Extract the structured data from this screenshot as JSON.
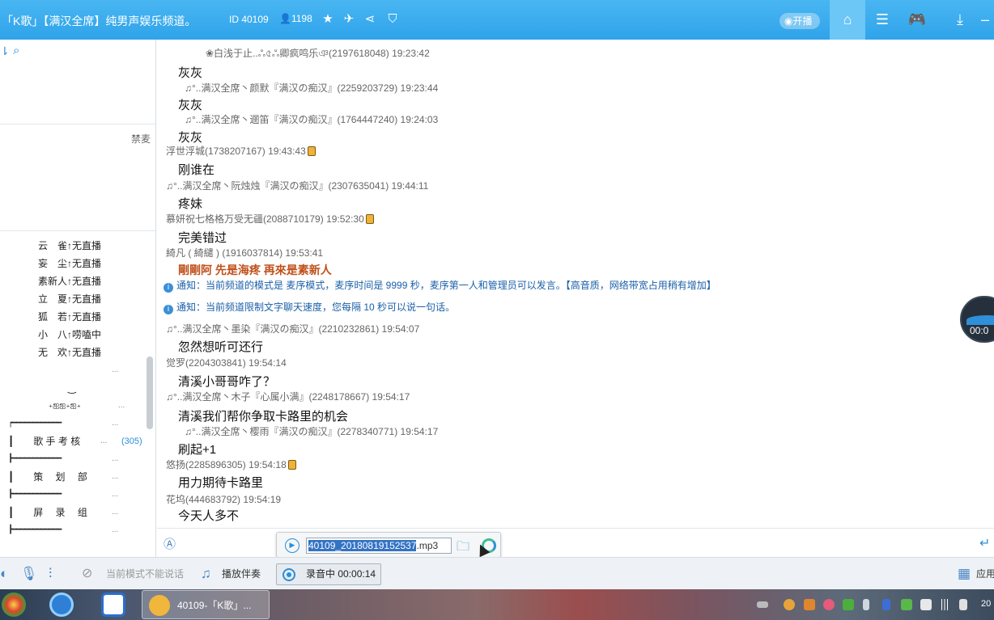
{
  "titlebar": {
    "title": "「K歌」【满汉全席】纯男声娱乐频道。",
    "id_label": "ID 40109",
    "user_count": "1198",
    "live_label": "开播",
    "icons": [
      "star-icon",
      "plane-icon",
      "share-icon",
      "shield-icon"
    ],
    "nav": [
      "home-icon",
      "list-icon",
      "gamepad-icon",
      "download-icon"
    ]
  },
  "left": {
    "ban_label": "禁麦",
    "members": [
      {
        "name": "云　雀",
        "status": "无直播"
      },
      {
        "name": "妄　尘",
        "status": "无直播"
      },
      {
        "name": "素新人",
        "status": "无直播"
      },
      {
        "name": "立　夏",
        "status": "无直播"
      },
      {
        "name": "狐　若",
        "status": "无直播"
      },
      {
        "name": "小　八",
        "status": "唠嗑中"
      },
      {
        "name": "无　欢",
        "status": "无直播"
      }
    ],
    "channels": [
      {
        "text": "",
        "dots": "..."
      },
      {
        "text": "‿",
        "dots": ""
      },
      {
        "text": "₊ஐஐ₊ஐ₊",
        "dots": "..."
      },
      {
        "text": "┍━━━━━━━━━━━━",
        "dots": "..."
      },
      {
        "text": "┃　　歌 手 考 核",
        "dots": "...",
        "count": "(305)"
      },
      {
        "text": "┣━━━━━━━━━━━━",
        "dots": "..."
      },
      {
        "text": "┃　　策　 划　 部",
        "dots": "..."
      },
      {
        "text": "┣━━━━━━━━━━━━",
        "dots": "..."
      },
      {
        "text": "┃　　屏　 录　 组",
        "dots": "..."
      },
      {
        "text": "┣━━━━━━━━━━━━",
        "dots": "..."
      }
    ]
  },
  "chat": {
    "lines": [
      {
        "kind": "meta",
        "text": "❀白浅于止..ஃ৫ஃ卿疯鸣乐ঞ(2197618048) 19:23:42",
        "indent": 60
      },
      {
        "kind": "msg",
        "text": "灰灰",
        "indent": 26
      },
      {
        "kind": "meta",
        "text": "♫°..满汉全席丶颜默『满汉の痴汉』(2259203729) 19:23:44",
        "indent": 34
      },
      {
        "kind": "msg",
        "text": "灰灰",
        "indent": 26
      },
      {
        "kind": "meta",
        "text": "♫°..满汉全席丶逦笛『满汉の痴汉』(1764447240) 19:24:03",
        "indent": 34
      },
      {
        "kind": "msg",
        "text": "灰灰",
        "indent": 26
      },
      {
        "kind": "meta",
        "text": "浮世浮城(1738207167) 19:43:43",
        "indent": 11,
        "phone": true
      },
      {
        "kind": "msg",
        "text": "刚谁在",
        "indent": 26
      },
      {
        "kind": "meta",
        "text": "♫°..满汉全席丶阮烛烛『满汉の痴汉』(2307635041) 19:44:11",
        "indent": 11
      },
      {
        "kind": "msg",
        "text": "疼妹",
        "indent": 26
      },
      {
        "kind": "meta",
        "text": "慕妍祝七格格万受无疆(2088710179) 19:52:30",
        "indent": 11,
        "phone": true
      },
      {
        "kind": "msg",
        "text": "完美错过",
        "indent": 26
      },
      {
        "kind": "meta",
        "text": "綺凡 ( 綺繾 ) (1916037814) 19:53:41",
        "indent": 11
      },
      {
        "kind": "hl",
        "text": "剛剛阿  先是海疼  再來是素新人",
        "indent": 26
      },
      {
        "kind": "notice",
        "text": "通知：当前频道的模式是 麦序模式，麦序时间是 9999 秒，麦序第一人和管理员可以发言。【高音质，网络带宽占用稍有增加】",
        "indent": 8
      },
      {
        "kind": "notice",
        "text": "通知：当前频道限制文字聊天速度，您每隔 10 秒可以说一句话。",
        "indent": 8
      },
      {
        "kind": "meta",
        "text": "♫°..满汉全席丶墨染『满汉の痴汉』(2210232861) 19:54:07",
        "indent": 11
      },
      {
        "kind": "msg",
        "text": "忽然想听可还行",
        "indent": 26
      },
      {
        "kind": "meta",
        "text": "觉罗(2204303841) 19:54:14",
        "indent": 11
      },
      {
        "kind": "msg",
        "text": "清溪小哥哥咋了？",
        "indent": 26
      },
      {
        "kind": "meta",
        "text": "♫°..满汉全席丶木子『心属小满』(2248178667) 19:54:17",
        "indent": 11
      },
      {
        "kind": "msg",
        "text": "清溪我们帮你争取卡路里的机会",
        "indent": 26
      },
      {
        "kind": "meta",
        "text": "♫°..满汉全席丶樱雨『满汉の痴汉』(2278340771) 19:54:17",
        "indent": 34
      },
      {
        "kind": "msg",
        "text": "刷起+1",
        "indent": 26
      },
      {
        "kind": "meta",
        "text": "悠扬(2285896305) 19:54:18",
        "indent": 11,
        "phone": true
      },
      {
        "kind": "msg",
        "text": "用力期待卡路里",
        "indent": 26
      },
      {
        "kind": "meta",
        "text": "花坞(444683792) 19:54:19",
        "indent": 11
      },
      {
        "kind": "msg",
        "text": "今天人多不",
        "indent": 26
      }
    ]
  },
  "recording": {
    "filename_selected": "40109_20180819152537",
    "filename_ext": ".mp3"
  },
  "toolbar": {
    "mode_text": "当前模式不能说话",
    "accompany": "播放伴奏",
    "recording_status": "录音中 00:00:14",
    "apps_label": "应用"
  },
  "floating": {
    "time": "00:0"
  },
  "taskbar": {
    "app_label": "40109-「K歌」...",
    "clock": "20"
  }
}
